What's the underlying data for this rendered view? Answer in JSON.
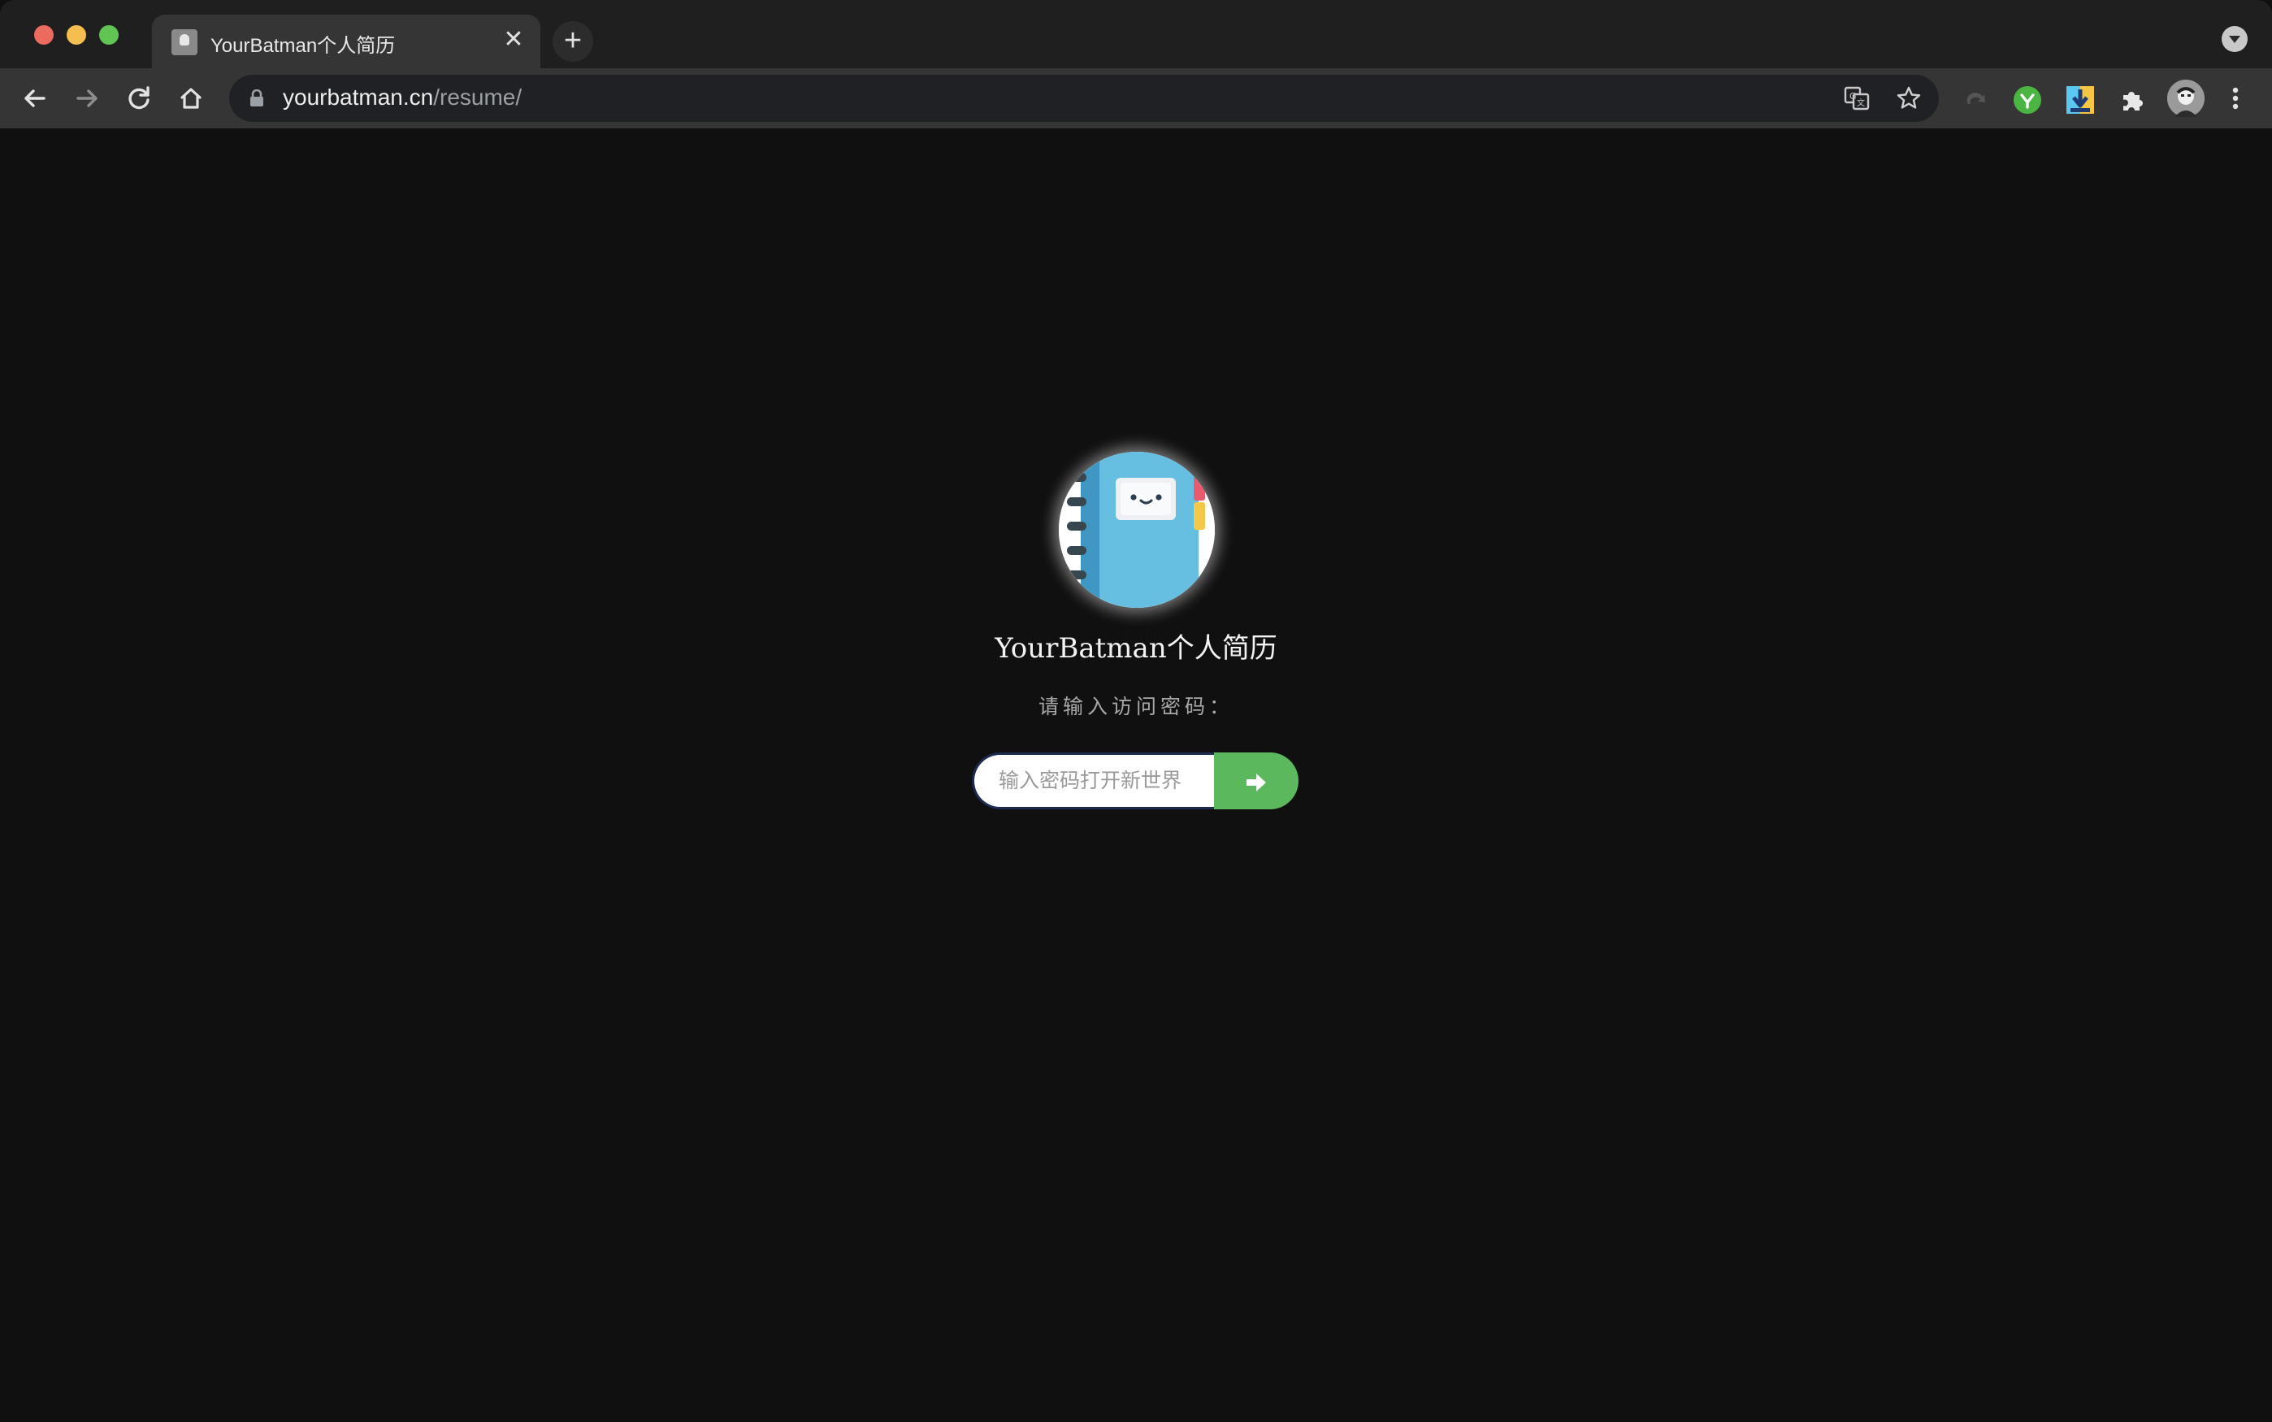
{
  "browser": {
    "tab": {
      "title": "YourBatman个人简历",
      "close_glyph": "✕"
    },
    "new_tab_glyph": "+",
    "url": {
      "host": "yourbatman.cn",
      "path": "/resume/"
    },
    "toolbar_icons": [
      "back-icon",
      "forward-icon",
      "reload-icon",
      "home-icon",
      "lock-icon",
      "translate-icon",
      "star-icon",
      "extension-gray-icon",
      "extension-green-icon",
      "extension-download-icon",
      "puzzle-icon",
      "profile-avatar",
      "more-icon"
    ]
  },
  "page": {
    "title": "YourBatman个人简历",
    "prompt": "请输入访问密码：",
    "password_placeholder": "输入密码打开新世界",
    "submit_glyph": "➜",
    "accent_color": "#5cb85c"
  }
}
